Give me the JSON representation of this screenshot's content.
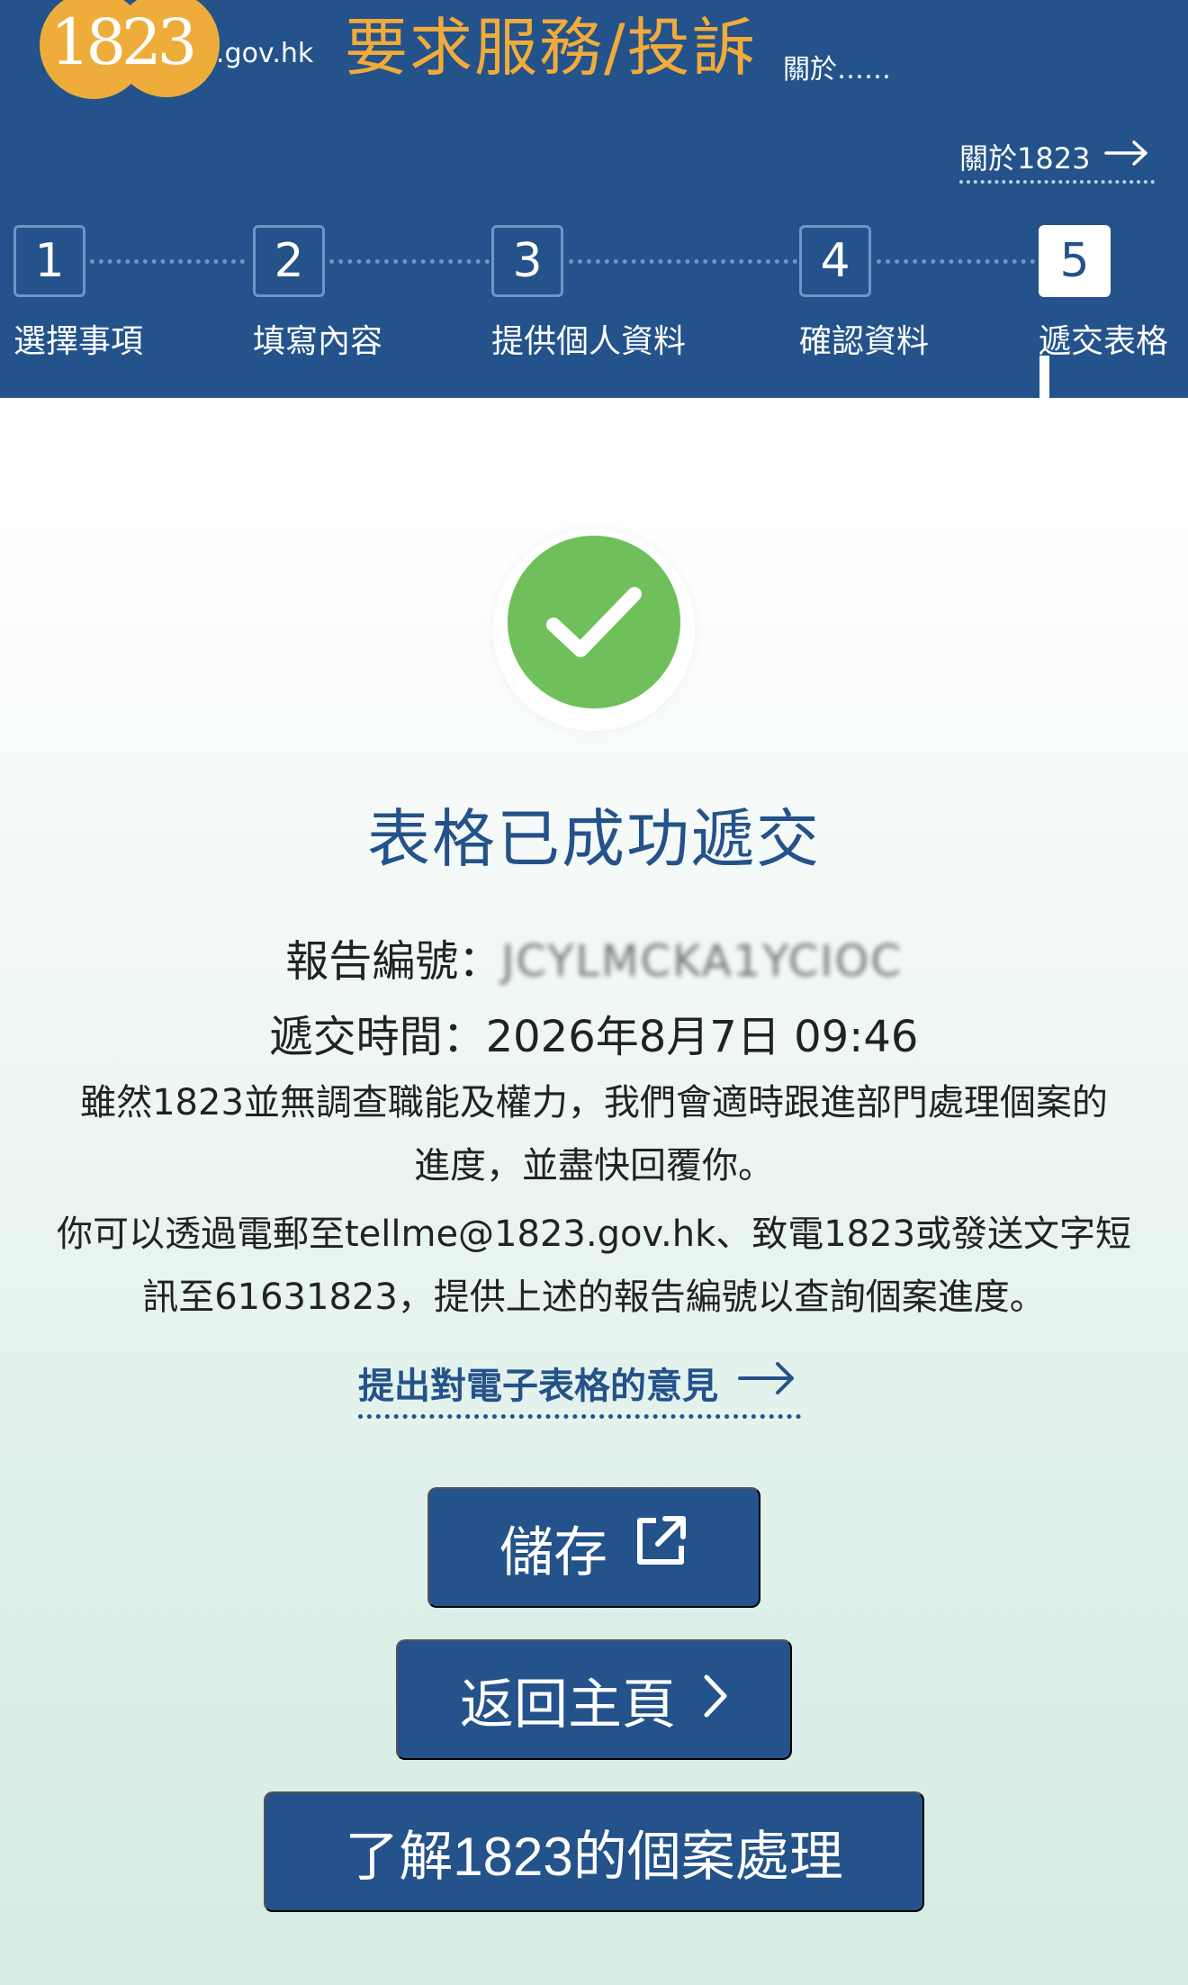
{
  "header": {
    "logo_text": "1823",
    "logo_suffix": ".gov.hk",
    "title": "要求服務/投訴",
    "subtitle": "關於……",
    "about_link": "關於1823"
  },
  "steps": [
    {
      "number": "1",
      "label": "選擇事項"
    },
    {
      "number": "2",
      "label": "填寫內容"
    },
    {
      "number": "3",
      "label": "提供個人資料"
    },
    {
      "number": "4",
      "label": "確認資料"
    },
    {
      "number": "5",
      "label": "遞交表格"
    }
  ],
  "active_step": 5,
  "success": {
    "title": "表格已成功遞交",
    "ref_label": "報告編號：",
    "ref_value": "JCYLMCKA1YCIOC",
    "time_label": "遞交時間：",
    "time_value": "2026年8月7日 09:46",
    "para1_line1": "雖然1823並無調查職能及權力，我們會適時跟進部門處理個案的",
    "para1_line2": "進度，並盡快回覆你。",
    "para2_line1": "你可以透過電郵至tellme@1823.gov.hk、致電1823或發送文字短",
    "para2_line2": "訊至61631823，提供上述的報告編號以查詢個案進度。",
    "feedback_link": "提出對電子表格的意見"
  },
  "buttons": {
    "save": "儲存",
    "home": "返回主頁",
    "learn": "了解1823的個案處理"
  },
  "icons": {
    "about_arrow": "arrow-right-icon",
    "check": "checkmark-icon",
    "save": "external-link-icon",
    "home": "chevron-right-icon"
  },
  "colors": {
    "header_bg": "#24528a",
    "accent_orange": "#f0ab3b",
    "success_green": "#6fbf5a",
    "primary_blue": "#24528a"
  }
}
